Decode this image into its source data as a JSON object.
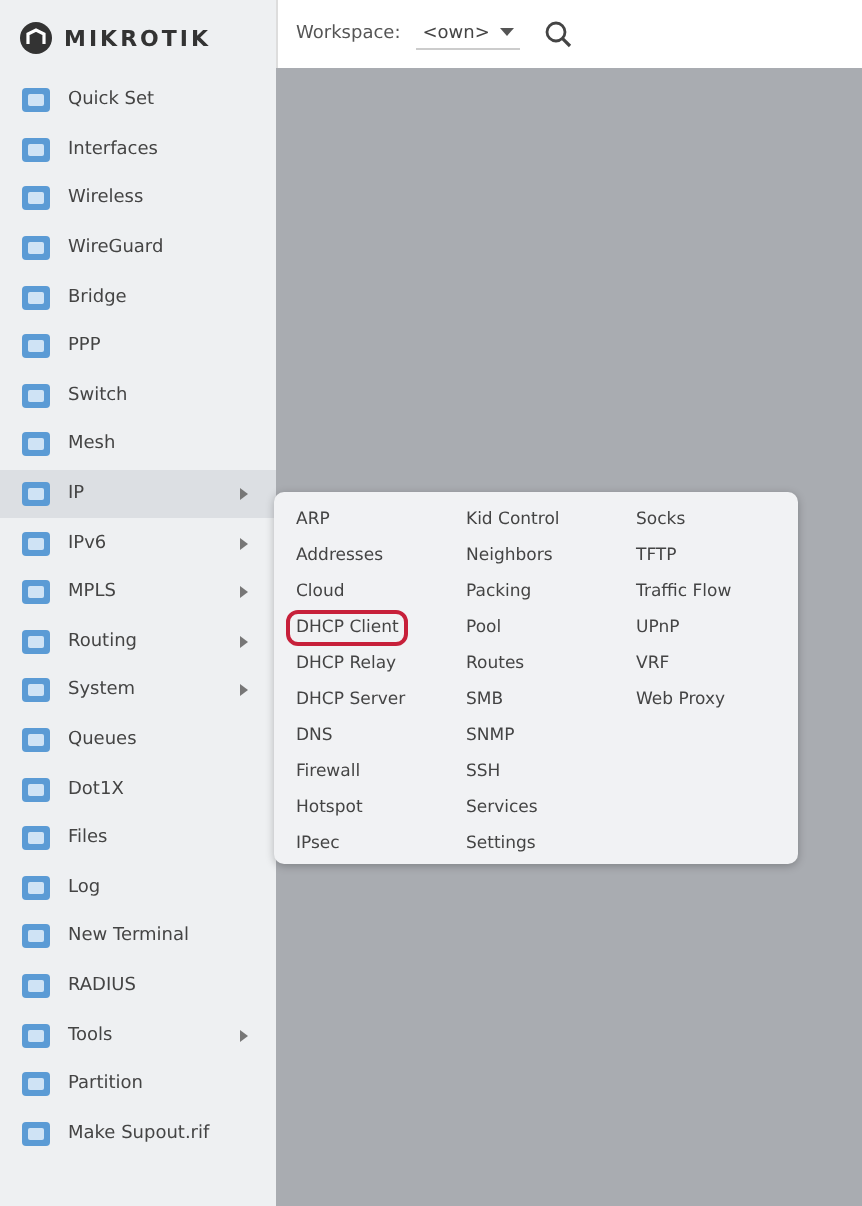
{
  "logo": {
    "text": "MIKROTIK"
  },
  "toolbar": {
    "label": "Workspace:",
    "value": "<own>"
  },
  "sidebar": {
    "items": [
      {
        "label": "Quick Set",
        "submenu": false,
        "selected": false
      },
      {
        "label": "Interfaces",
        "submenu": false,
        "selected": false
      },
      {
        "label": "Wireless",
        "submenu": false,
        "selected": false
      },
      {
        "label": "WireGuard",
        "submenu": false,
        "selected": false
      },
      {
        "label": "Bridge",
        "submenu": false,
        "selected": false
      },
      {
        "label": "PPP",
        "submenu": false,
        "selected": false
      },
      {
        "label": "Switch",
        "submenu": false,
        "selected": false
      },
      {
        "label": "Mesh",
        "submenu": false,
        "selected": false
      },
      {
        "label": "IP",
        "submenu": true,
        "selected": true
      },
      {
        "label": "IPv6",
        "submenu": true,
        "selected": false
      },
      {
        "label": "MPLS",
        "submenu": true,
        "selected": false
      },
      {
        "label": "Routing",
        "submenu": true,
        "selected": false
      },
      {
        "label": "System",
        "submenu": true,
        "selected": false
      },
      {
        "label": "Queues",
        "submenu": false,
        "selected": false
      },
      {
        "label": "Dot1X",
        "submenu": false,
        "selected": false
      },
      {
        "label": "Files",
        "submenu": false,
        "selected": false
      },
      {
        "label": "Log",
        "submenu": false,
        "selected": false
      },
      {
        "label": "New Terminal",
        "submenu": false,
        "selected": false
      },
      {
        "label": "RADIUS",
        "submenu": false,
        "selected": false
      },
      {
        "label": "Tools",
        "submenu": true,
        "selected": false
      },
      {
        "label": "Partition",
        "submenu": false,
        "selected": false
      },
      {
        "label": "Make Supout.rif",
        "submenu": false,
        "selected": false
      }
    ]
  },
  "submenu": {
    "columns": [
      [
        {
          "label": "ARP",
          "circled": false
        },
        {
          "label": "Addresses",
          "circled": false
        },
        {
          "label": "Cloud",
          "circled": false
        },
        {
          "label": "DHCP Client",
          "circled": true
        },
        {
          "label": "DHCP Relay",
          "circled": false
        },
        {
          "label": "DHCP Server",
          "circled": false
        },
        {
          "label": "DNS",
          "circled": false
        },
        {
          "label": "Firewall",
          "circled": false
        },
        {
          "label": "Hotspot",
          "circled": false
        },
        {
          "label": "IPsec",
          "circled": false
        }
      ],
      [
        {
          "label": "Kid Control",
          "circled": false
        },
        {
          "label": "Neighbors",
          "circled": false
        },
        {
          "label": "Packing",
          "circled": false
        },
        {
          "label": "Pool",
          "circled": false
        },
        {
          "label": "Routes",
          "circled": false
        },
        {
          "label": "SMB",
          "circled": false
        },
        {
          "label": "SNMP",
          "circled": false
        },
        {
          "label": "SSH",
          "circled": false
        },
        {
          "label": "Services",
          "circled": false
        },
        {
          "label": "Settings",
          "circled": false
        }
      ],
      [
        {
          "label": "Socks",
          "circled": false
        },
        {
          "label": "TFTP",
          "circled": false
        },
        {
          "label": "Traffic Flow",
          "circled": false
        },
        {
          "label": "UPnP",
          "circled": false
        },
        {
          "label": "VRF",
          "circled": false
        },
        {
          "label": "Web Proxy",
          "circled": false
        }
      ]
    ]
  }
}
